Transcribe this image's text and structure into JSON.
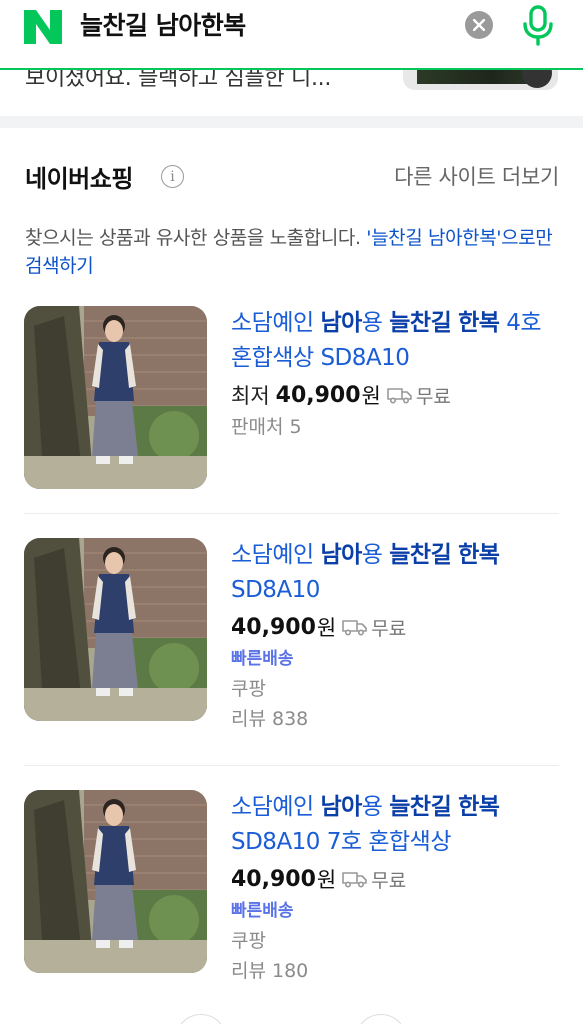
{
  "search": {
    "query": "늘찬길 남아한복",
    "logo_letter": "N",
    "brand_color": "#03c75a"
  },
  "previous_snippet": {
    "text": "보이셨어요. 블랙하고 심플한 디..."
  },
  "shopping": {
    "title": "네이버쇼핑",
    "info_icon": "i",
    "more_link": "다른 사이트 더보기",
    "notice_prefix": "찾으시는 상품과 유사한 상품을 노출합니다. ",
    "notice_link": "'늘찬길 남아한복'으로만 검색하기",
    "products": [
      {
        "title_parts": [
          "소담예인 ",
          "남아",
          "용 ",
          "늘찬길",
          " ",
          "한복",
          " 4호 혼합색상 SD8A10"
        ],
        "price_prefix": "최저",
        "price": "40,900",
        "won": "원",
        "shipping": "무료",
        "fast_delivery": "",
        "seller": "",
        "meta": "판매처 5"
      },
      {
        "title_parts": [
          "소담예인 ",
          "남아",
          "용 ",
          "늘찬길",
          " ",
          "한복",
          " SD8A10"
        ],
        "price_prefix": "",
        "price": "40,900",
        "won": "원",
        "shipping": "무료",
        "fast_delivery": "빠른배송",
        "seller": "쿠팡",
        "meta": "리뷰 838"
      },
      {
        "title_parts": [
          "소담예인 ",
          "남아",
          "용 ",
          "늘찬길",
          " ",
          "한복",
          " SD8A10 7호 혼합색상"
        ],
        "price_prefix": "",
        "price": "40,900",
        "won": "원",
        "shipping": "무료",
        "fast_delivery": "빠른배송",
        "seller": "쿠팡",
        "meta": "리뷰 180"
      }
    ]
  },
  "colors": {
    "link_blue": "#1a5dd6",
    "fast_delivery": "#5a73e8"
  }
}
